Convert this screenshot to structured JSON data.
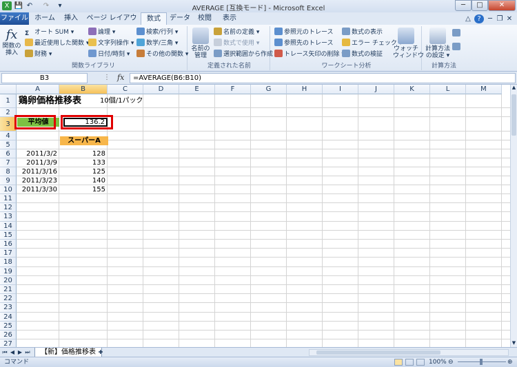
{
  "window": {
    "title": "AVERAGE [互換モード] - Microsoft Excel",
    "minimize": "─",
    "maximize": "□",
    "close": "✕"
  },
  "tabs": [
    "ファイル",
    "ホーム",
    "挿入",
    "ページ レイアウト",
    "数式",
    "データ",
    "校閲",
    "表示"
  ],
  "active_tab": "数式",
  "ribbon": {
    "insert_function": "関数の\n挿入",
    "g1": {
      "autosum": "オート SUM ▾",
      "recent": "最近使用した関数 ▾",
      "financial": "財務 ▾",
      "logical": "論理 ▾",
      "text": "文字列操作 ▾",
      "datetime": "日付/時刻 ▾",
      "lookup": "検索/行列 ▾",
      "math": "数学/三角 ▾",
      "more": "その他の関数 ▾",
      "label": "関数ライブラリ"
    },
    "g2": {
      "name_mgr": "名前の\n管理",
      "define": "名前の定義 ▾",
      "use_in_formula": "数式で使用 ▾",
      "create": "選択範囲から作成",
      "label": "定義された名前"
    },
    "g3": {
      "trace_prec": "参照元のトレース",
      "trace_dep": "参照先のトレース",
      "remove_arrows": "トレース矢印の削除 ▾",
      "show_formulas": "数式の表示",
      "error_check": "エラー チェック ▾",
      "eval": "数式の検証",
      "watch": "ウォッチ\nウィンドウ",
      "label": "ワークシート分析"
    },
    "g4": {
      "calc_opts": "計算方法\nの設定 ▾",
      "label": "計算方法"
    }
  },
  "namebox": "B3",
  "fx": "fx",
  "formula": "=AVERAGE(B6:B10)",
  "columns": [
    "A",
    "B",
    "C",
    "D",
    "E",
    "F",
    "G",
    "H",
    "I",
    "J",
    "K",
    "L",
    "M"
  ],
  "rows": [
    "1",
    "2",
    "3",
    "4",
    "5",
    "6",
    "7",
    "8",
    "9",
    "10",
    "11",
    "12",
    "13",
    "14",
    "15",
    "16",
    "17",
    "18",
    "19",
    "20",
    "21",
    "22",
    "23",
    "24",
    "25",
    "26",
    "27"
  ],
  "cells": {
    "a1": "鶏卵価格推移表",
    "c1": "10個/1パック",
    "a3": "平均値",
    "b3": "136.2",
    "b5": "スーパーA",
    "dates": [
      "2011/3/2",
      "2011/3/9",
      "2011/3/16",
      "2011/3/23",
      "2011/3/30"
    ],
    "prices": [
      "128",
      "133",
      "125",
      "140",
      "155"
    ]
  },
  "sheet_tab": "【新】価格推移表",
  "status": {
    "mode": "コマンド",
    "zoom": "100%"
  },
  "colors": {
    "label_fill": "#7dc242",
    "header_fill": "#f7b64a",
    "highlight_border": "#e00000"
  }
}
